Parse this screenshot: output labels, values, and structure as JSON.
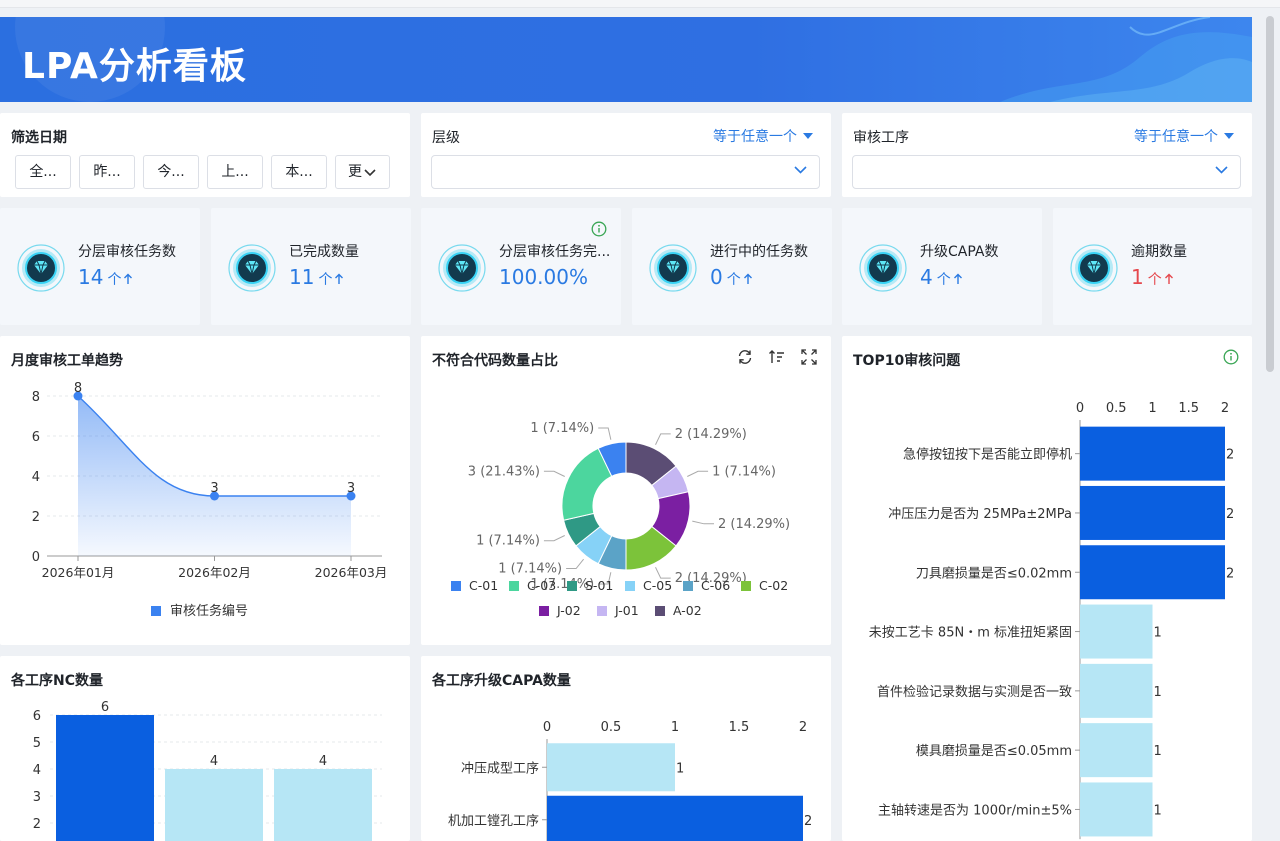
{
  "header": {
    "title": "LPA分析看板"
  },
  "filters": {
    "date": {
      "label": "筛选日期",
      "buttons": [
        "全...",
        "昨...",
        "今...",
        "上...",
        "本..."
      ],
      "more": "更"
    },
    "level": {
      "label": "层级",
      "operator": "等于任意一个",
      "value": ""
    },
    "process": {
      "label": "审核工序",
      "operator": "等于任意一个",
      "value": ""
    }
  },
  "kpis": [
    {
      "label": "分层审核任务数",
      "value": "14",
      "unit": "个",
      "color": "#2a7ae2"
    },
    {
      "label": "已完成数量",
      "value": "11",
      "unit": "个",
      "color": "#2a7ae2"
    },
    {
      "label": "分层审核任务完...",
      "value": "100.00%",
      "unit": "",
      "color": "#2a7ae2"
    },
    {
      "label": "进行中的任务数",
      "value": "0",
      "unit": "个",
      "color": "#2a7ae2"
    },
    {
      "label": "升级CAPA数",
      "value": "4",
      "unit": "个",
      "color": "#2a7ae2"
    },
    {
      "label": "逾期数量",
      "value": "1",
      "unit": "个",
      "color": "#e5484d"
    }
  ],
  "chart_data": [
    {
      "id": "monthly",
      "type": "area",
      "title": "月度审核工单趋势",
      "categories": [
        "2026年01月",
        "2026年02月",
        "2026年03月"
      ],
      "series": [
        {
          "name": "审核任务编号",
          "values": [
            8,
            3,
            3
          ]
        }
      ],
      "ylim": [
        0,
        8
      ],
      "yticks": [
        0,
        2,
        4,
        6,
        8
      ],
      "legend": "bottom",
      "grid": true,
      "colors": {
        "line": "#3b82f0"
      }
    },
    {
      "id": "donut",
      "type": "pie",
      "title": "不符合代码数量占比",
      "slices": [
        {
          "name": "A-02",
          "value": 2,
          "label": "2 (14.29%)",
          "color": "#5b4d74"
        },
        {
          "name": "J-01",
          "value": 1,
          "label": "1 (7.14%)",
          "color": "#c5b6f2"
        },
        {
          "name": "J-02",
          "value": 2,
          "label": "2 (14.29%)",
          "color": "#7b1fa2"
        },
        {
          "name": "C-02",
          "value": 2,
          "label": "2 (14.29%)",
          "color": "#7cc33a"
        },
        {
          "name": "C-06",
          "value": 1,
          "label": "1 (7.14%)",
          "color": "#5ba3c7"
        },
        {
          "name": "C-05",
          "value": 1,
          "label": "1 (7.14%)",
          "color": "#86d2f7"
        },
        {
          "name": "S-01",
          "value": 1,
          "label": "1 (7.14%)",
          "color": "#2f9985"
        },
        {
          "name": "C-03",
          "value": 3,
          "label": "3 (21.43%)",
          "color": "#4cd69e"
        },
        {
          "name": "C-01",
          "value": 1,
          "label": "1 (7.14%)",
          "color": "#3b82f0"
        }
      ],
      "legend_order": [
        "C-01",
        "C-03",
        "S-01",
        "C-05",
        "C-06",
        "C-02",
        "J-02",
        "J-01",
        "A-02"
      ],
      "legend": "bottom"
    },
    {
      "id": "top10",
      "type": "bar",
      "orientation": "horizontal",
      "title": "TOP10审核问题",
      "categories": [
        "急停按钮按下是否能立即停机",
        "冲压压力是否为 25MPa±2MPa",
        "刀具磨损量是否≤0.02mm",
        "未按工艺卡 85N・m 标准扭矩紧固",
        "首件检验记录数据与实测是否一致",
        "模具磨损量是否≤0.05mm",
        "主轴转速是否为 1000r/min±5%"
      ],
      "values": [
        2,
        2,
        2,
        1,
        1,
        1,
        1
      ],
      "xlim": [
        0,
        2
      ],
      "xticks": [
        "0",
        "0.5",
        "1",
        "1.5",
        "2"
      ],
      "colors": {
        "high": "#0a5fe0",
        "low": "#b6e6f5"
      }
    },
    {
      "id": "nc",
      "type": "bar",
      "title": "各工序NC数量",
      "categories": [
        "",
        "",
        ""
      ],
      "values": [
        6,
        4,
        4
      ],
      "yticks": [
        2,
        3,
        4,
        5,
        6
      ],
      "colors": {
        "high": "#0a5fe0",
        "low": "#b6e6f5"
      }
    },
    {
      "id": "capa",
      "type": "bar",
      "orientation": "horizontal",
      "title": "各工序升级CAPA数量",
      "categories": [
        "冲压成型工序",
        "机加工镗孔工序"
      ],
      "values": [
        1,
        2
      ],
      "xlim": [
        0,
        2
      ],
      "xticks": [
        "0",
        "0.5",
        "1",
        "1.5",
        "2"
      ],
      "colors": {
        "high": "#0a5fe0",
        "low": "#b6e6f5"
      }
    }
  ]
}
